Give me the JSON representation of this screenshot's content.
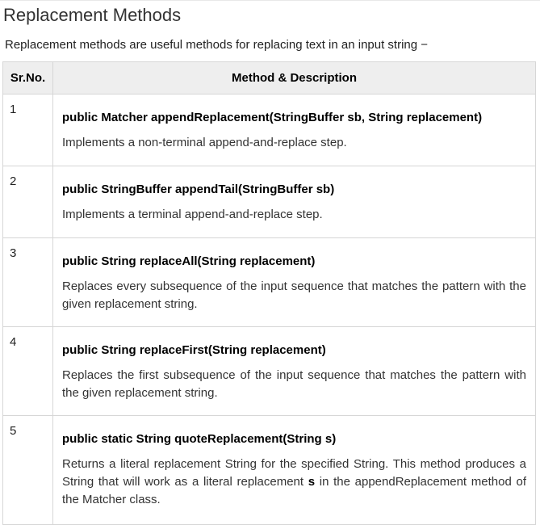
{
  "title": "Replacement Methods",
  "intro": "Replacement methods are useful methods for replacing text in an input string −",
  "table": {
    "headers": [
      "Sr.No.",
      "Method & Description"
    ],
    "rows": [
      {
        "no": "1",
        "signature": "public Matcher appendReplacement(StringBuffer sb, String replacement)",
        "description": "Implements a non-terminal append-and-replace step."
      },
      {
        "no": "2",
        "signature": "public StringBuffer appendTail(StringBuffer sb)",
        "description": "Implements a terminal append-and-replace step."
      },
      {
        "no": "3",
        "signature": "public String replaceAll(String replacement)",
        "description": "Replaces every subsequence of the input sequence that matches the pattern with the given replacement string."
      },
      {
        "no": "4",
        "signature": "public String replaceFirst(String replacement)",
        "description": "Replaces the first subsequence of the input sequence that matches the pattern with the given replacement string."
      },
      {
        "no": "5",
        "signature": "public static String quoteReplacement(String s)",
        "description_before": "Returns a literal replacement String for the specified String. This method produces a String that will work as a literal replacement",
        "description_bold": "s",
        "description_after": "in the appendReplacement method of the Matcher class."
      }
    ]
  }
}
